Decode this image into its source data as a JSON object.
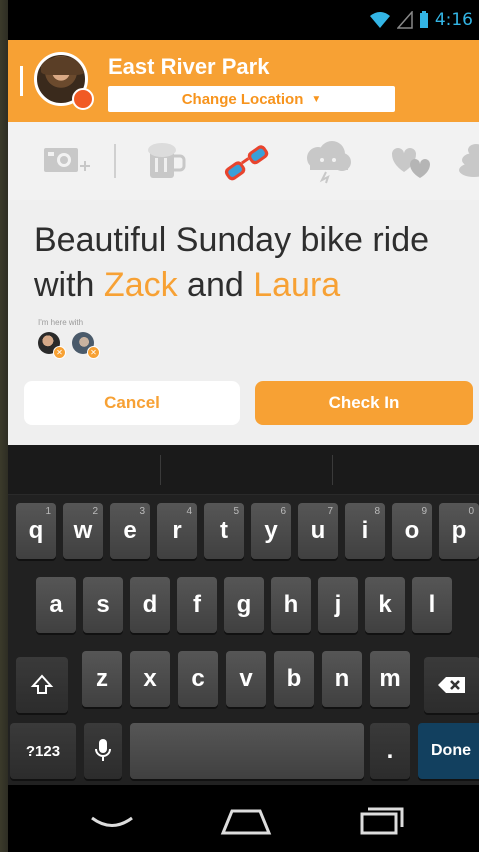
{
  "status_bar": {
    "time": "4:16"
  },
  "header": {
    "venue": "East River Park",
    "change_location": "Change Location"
  },
  "icons": [
    "camera-add-icon",
    "beer-mug-icon",
    "sunglasses-icon",
    "storm-cloud-icon",
    "hearts-icon",
    "stack-icon"
  ],
  "message": {
    "prefix": "Beautiful Sunday bike ride with ",
    "friend1": "Zack",
    "middle": " and ",
    "friend2": "Laura"
  },
  "here_with_label": "I'm here with",
  "buttons": {
    "cancel": "Cancel",
    "check_in": "Check In"
  },
  "keyboard": {
    "row1": [
      "q",
      "w",
      "e",
      "r",
      "t",
      "y",
      "u",
      "i",
      "o",
      "p"
    ],
    "row1_hints": [
      "1",
      "2",
      "3",
      "4",
      "5",
      "6",
      "7",
      "8",
      "9",
      "0"
    ],
    "row2": [
      "a",
      "s",
      "d",
      "f",
      "g",
      "h",
      "j",
      "k",
      "l"
    ],
    "row3": [
      "z",
      "x",
      "c",
      "v",
      "b",
      "n",
      "m"
    ],
    "symbols": "?123",
    "period": ".",
    "done": "Done"
  },
  "colors": {
    "accent": "#f7a134",
    "status_blue": "#33b5e5",
    "done_key": "#12405f"
  }
}
